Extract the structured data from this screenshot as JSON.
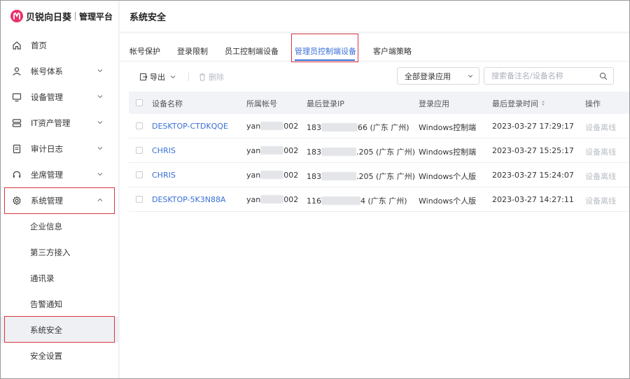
{
  "brand": {
    "name": "贝锐向日葵",
    "sub": "管理平台",
    "accent": "#e8336b"
  },
  "sidebar": {
    "items": [
      {
        "label": "首页",
        "icon": "home-icon"
      },
      {
        "label": "帐号体系",
        "icon": "user-icon",
        "expandable": true
      },
      {
        "label": "设备管理",
        "icon": "monitor-icon",
        "expandable": true
      },
      {
        "label": "IT资产管理",
        "icon": "server-icon",
        "expandable": true
      },
      {
        "label": "审计日志",
        "icon": "document-icon",
        "expandable": true
      },
      {
        "label": "坐席管理",
        "icon": "headset-icon",
        "expandable": true
      },
      {
        "label": "系统管理",
        "icon": "gear-icon",
        "expandable": true,
        "expanded": true
      }
    ],
    "subitems": [
      {
        "label": "企业信息"
      },
      {
        "label": "第三方接入"
      },
      {
        "label": "通讯录"
      },
      {
        "label": "告警通知"
      },
      {
        "label": "系统安全",
        "active": true
      },
      {
        "label": "安全设置"
      }
    ]
  },
  "header": {
    "title": "系统安全"
  },
  "tabs": [
    {
      "label": "帐号保护"
    },
    {
      "label": "登录限制"
    },
    {
      "label": "员工控制端设备"
    },
    {
      "label": "管理员控制端设备",
      "active": true
    },
    {
      "label": "客户端策略"
    }
  ],
  "toolbar": {
    "export_label": "导出",
    "delete_label": "删除",
    "app_select_value": "全部登录应用",
    "search_placeholder": "搜索备注名/设备名称"
  },
  "table": {
    "columns": [
      "设备名称",
      "所属帐号",
      "最后登录IP",
      "登录应用",
      "最后登录时间",
      "操作"
    ],
    "rows": [
      {
        "device": "DESKTOP-CTDKQQE",
        "account_pre": "yan",
        "account_post": "002",
        "ip_pre": "183",
        "ip_post": "66 (广东 广州)",
        "app": "Windows控制端",
        "time": "2023-03-27 17:29:17",
        "op": "设备离线"
      },
      {
        "device": "CHRIS",
        "account_pre": "yan",
        "account_post": "002",
        "ip_pre": "183",
        "ip_post": ".205 (广东 广州)",
        "app": "Windows控制端",
        "time": "2023-03-27 15:25:17",
        "op": "设备离线"
      },
      {
        "device": "CHRIS",
        "account_pre": "yan",
        "account_post": "002",
        "ip_pre": "183",
        "ip_post": ".205 (广东 广州)",
        "app": "Windows个人版",
        "time": "2023-03-27 15:24:07",
        "op": "设备离线"
      },
      {
        "device": "DESKTOP-5K3N88A",
        "account_pre": "yan",
        "account_post": "002",
        "ip_pre": "116",
        "ip_post": "4 (广东 广州)",
        "app": "Windows个人版",
        "time": "2023-03-27 14:27:11",
        "op": "设备离线"
      }
    ]
  },
  "colors": {
    "link": "#3a6fd8",
    "highlight": "#d9363e",
    "muted": "#b7bcc4"
  }
}
